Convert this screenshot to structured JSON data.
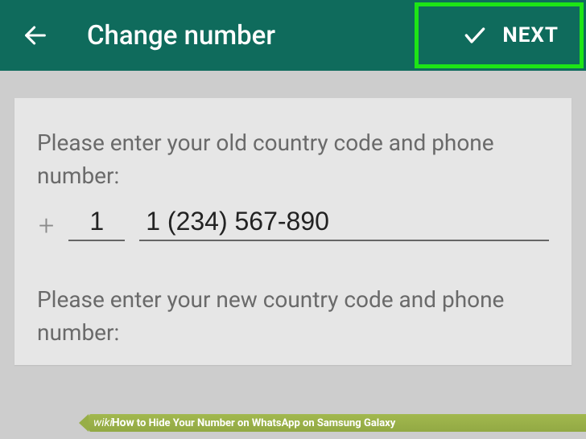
{
  "app_bar": {
    "title": "Change number",
    "next_label": "NEXT"
  },
  "form": {
    "old_instruction": "Please enter your old country code and phone number:",
    "old_country_code": "1",
    "old_phone_number": "1 (234) 567-890",
    "new_instruction": "Please enter your new country code and phone number:"
  },
  "banner": {
    "wiki": "wiki",
    "how": "How",
    "article_title": " to Hide Your Number on WhatsApp on Samsung Galaxy"
  },
  "colors": {
    "app_bar_bg": "#0f6b5c",
    "card_bg": "#e6e6e6",
    "highlight": "#1de516",
    "banner_bg": "#97ae47"
  }
}
